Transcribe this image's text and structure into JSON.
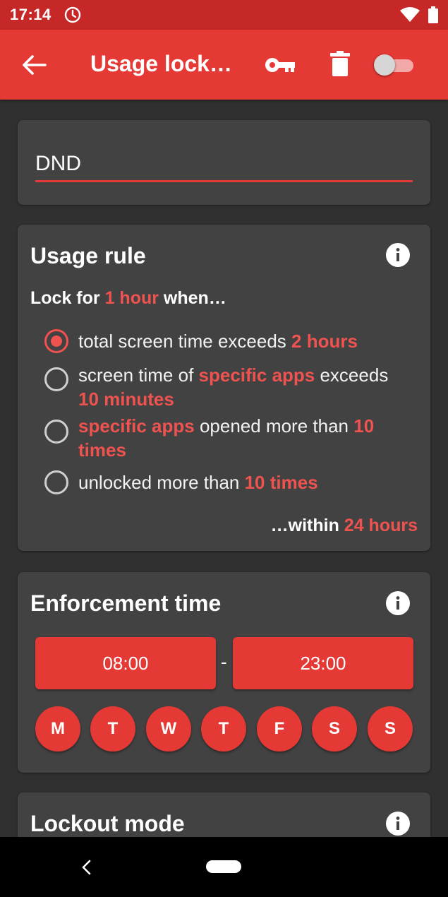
{
  "status_bar": {
    "time": "17:14"
  },
  "app_bar": {
    "title": "Usage lock…"
  },
  "name_card": {
    "name_value": "DND"
  },
  "usage_rule": {
    "title": "Usage rule",
    "lock_prefix": "Lock for ",
    "lock_duration": "1 hour",
    "lock_suffix": " when…",
    "options": [
      {
        "text_a": "total screen time exceeds ",
        "hl_a": "2 hours",
        "checked": true
      },
      {
        "text_a": "screen time of ",
        "hl_a": "specific apps",
        "text_b": " exceeds ",
        "hl_b": "10 minutes",
        "checked": false
      },
      {
        "hl_a": "specific apps",
        "text_a": " opened more than ",
        "hl_b": "10 times",
        "checked": false
      },
      {
        "text_a": "unlocked more than ",
        "hl_a": "10 times",
        "checked": false
      }
    ],
    "within_prefix": "…within ",
    "within_value": "24 hours"
  },
  "enforcement": {
    "title": "Enforcement time",
    "start_time": "08:00",
    "separator": "-",
    "end_time": "23:00",
    "days": [
      "M",
      "T",
      "W",
      "T",
      "F",
      "S",
      "S"
    ]
  },
  "lockout": {
    "title": "Lockout mode"
  },
  "colors": {
    "accent": "#e53935",
    "status": "#c62828",
    "card": "#424242",
    "background": "#303030"
  }
}
